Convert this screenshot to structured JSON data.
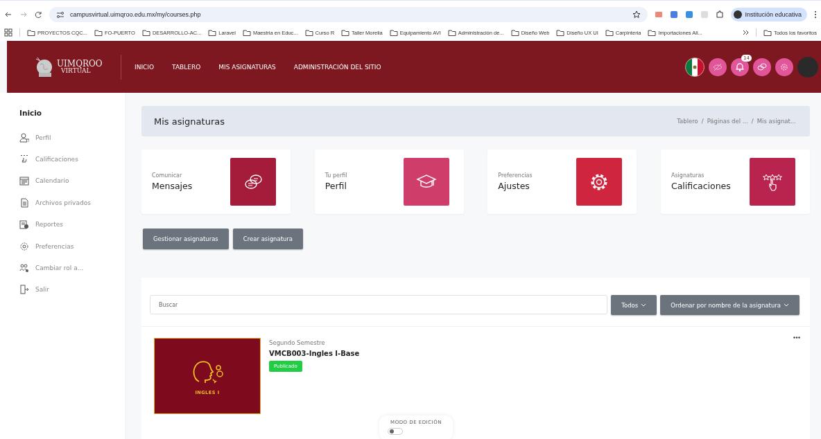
{
  "browser": {
    "url": "campusvirtual.uimqroo.edu.mx/my/courses.php",
    "profile": "Institución educativa"
  },
  "bookmarks": [
    "PROYECTOS CQC...",
    "FO-PUERTO",
    "DESARROLLO-AC...",
    "Laravel",
    "Maestria en Educ...",
    "Curso R",
    "Taller Morelia",
    "Equipamiento AVI",
    "Administración de...",
    "Diseño Web",
    "Diseño UX UI",
    "Carpinteria",
    "Importaciones Ali..."
  ],
  "all_bookmarks": "Todos los favoritos",
  "header": {
    "logo_top": "UIMQROO",
    "logo_bottom": "VIRTUAL",
    "nav": [
      "INICIO",
      "TABLERO",
      "MIS ASIGNATURAS",
      "ADMINISTRACIÓN DEL SITIO"
    ],
    "notifications": "14"
  },
  "sidebar": {
    "title": "Inicio",
    "items": [
      "Perfil",
      "Calificaciones",
      "Calendario",
      "Archivos privados",
      "Reportes",
      "Preferencias",
      "Cambiar rol a...",
      "Salir"
    ]
  },
  "page": {
    "title": "Mis asignaturas",
    "breadcrumb": [
      "Tablero",
      "Páginas del ...",
      "Mis asignat..."
    ],
    "breadcrumb_separator": "/"
  },
  "cards": [
    {
      "subtitle": "Comunicar",
      "title": "Mensajes",
      "color": "#a51c3a"
    },
    {
      "subtitle": "Tu perfil",
      "title": "Perfil",
      "color": "#cf3e6a"
    },
    {
      "subtitle": "Preferencias",
      "title": "Ajustes",
      "color": "#d0253f"
    },
    {
      "subtitle": "Asignaturas",
      "title": "Calificaciones",
      "color": "#b8244e"
    }
  ],
  "buttons": [
    "Gestionar asignaturas",
    "Crear asignatura"
  ],
  "filters": {
    "search_placeholder": "Buscar",
    "grouping": "Todos",
    "sort": "Ordenar por nombre de la asignatura"
  },
  "courses": [
    {
      "category": "Segundo Semestre",
      "name": "VMCB003-Ingles I-Base",
      "status": "Publicado",
      "image_caption": "INGLES I"
    }
  ],
  "edit_mode": {
    "label": "MODO DE EDICIÓN",
    "on": false
  }
}
